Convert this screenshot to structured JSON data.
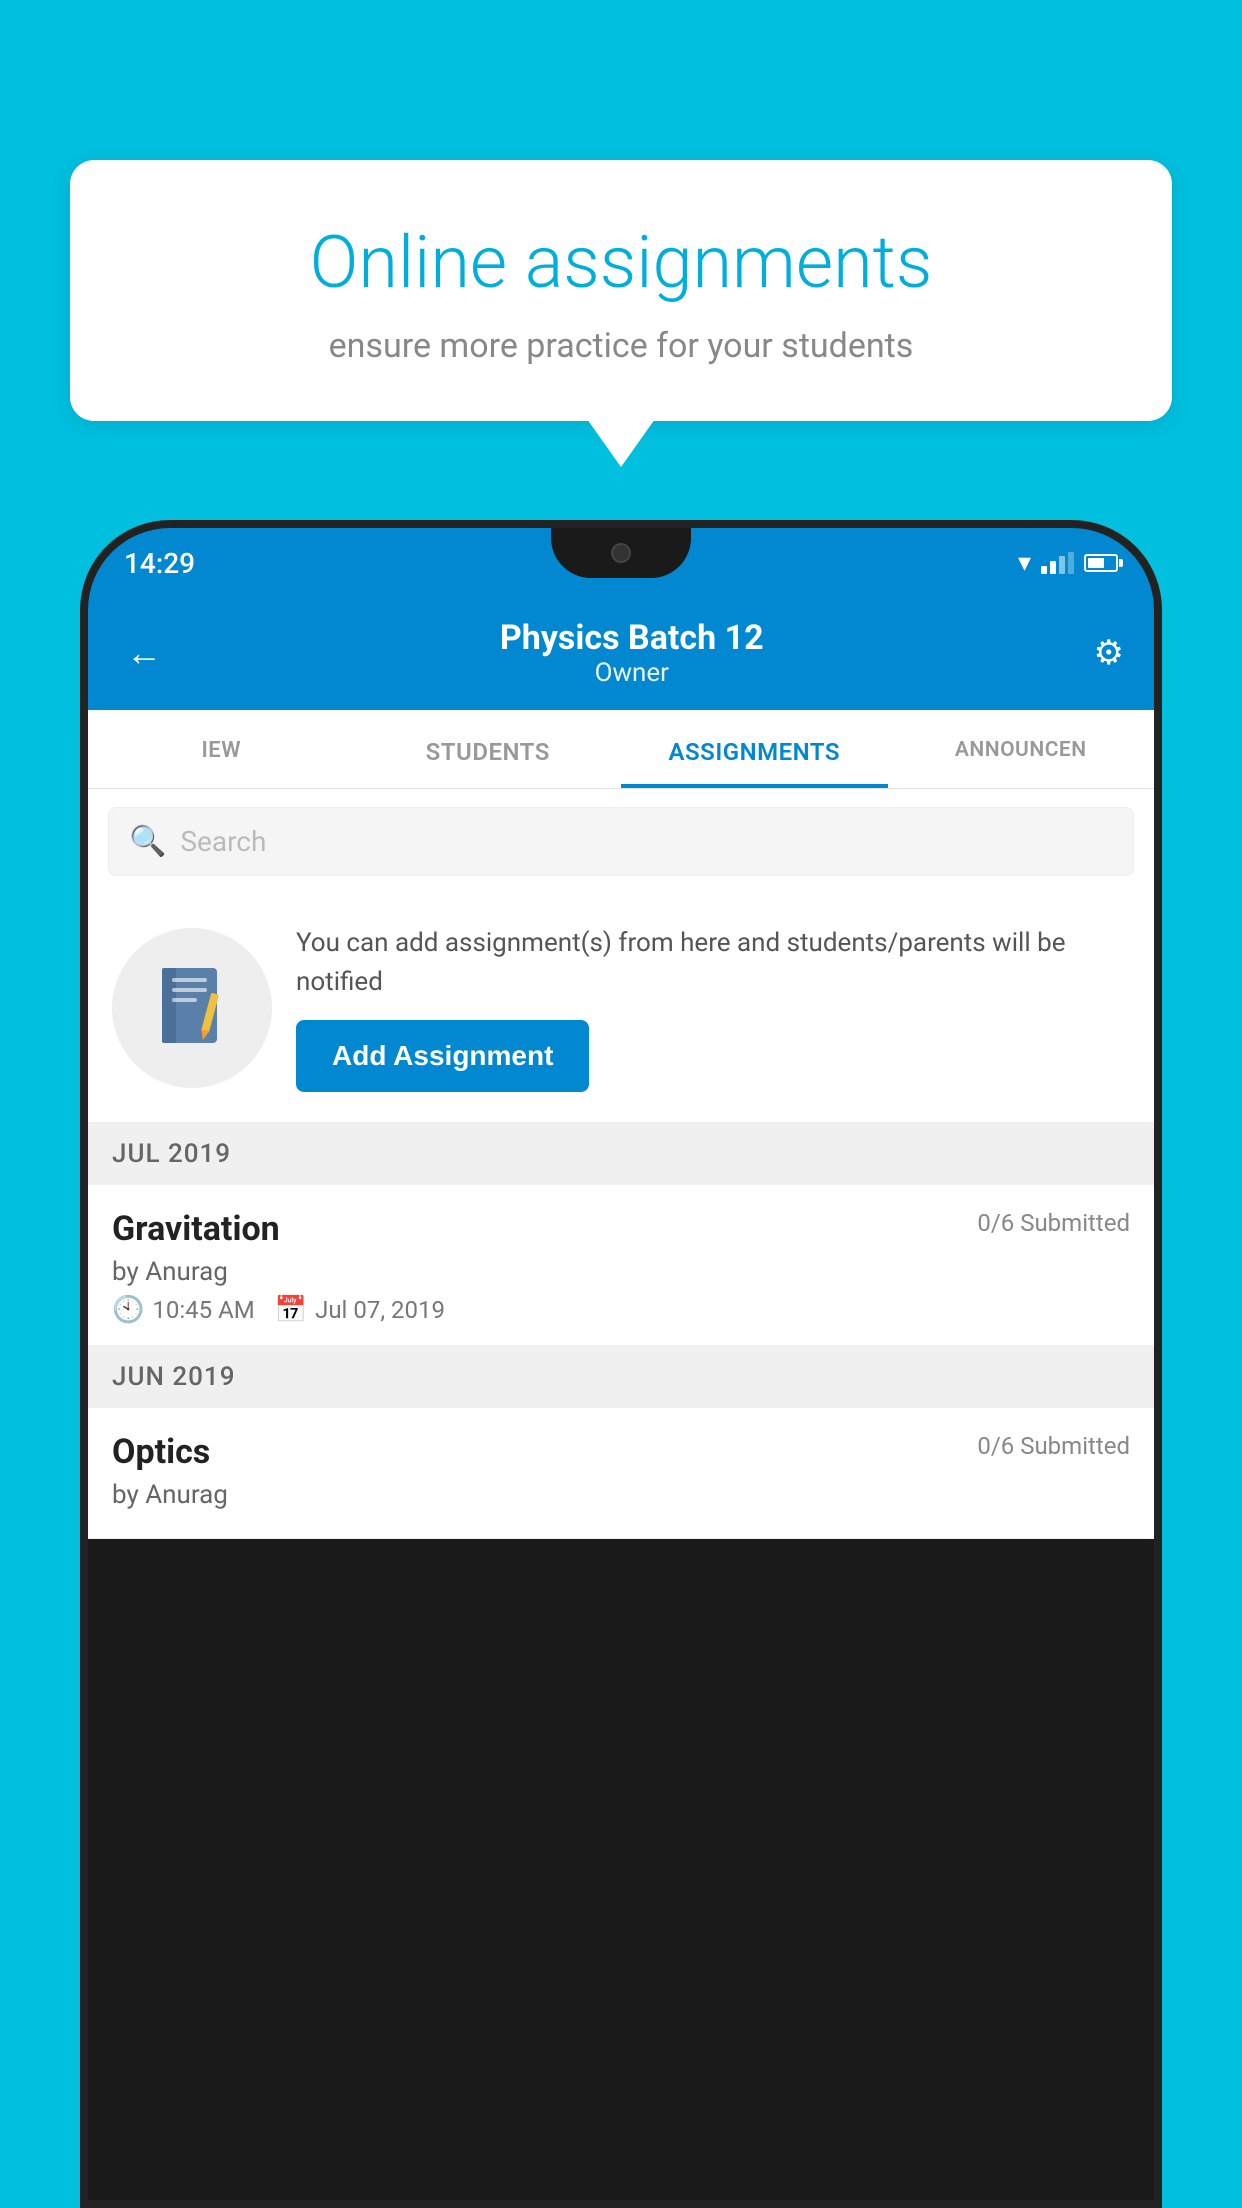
{
  "background": {
    "color": "#00BFDF"
  },
  "speech_bubble": {
    "title": "Online assignments",
    "subtitle": "ensure more practice for your students"
  },
  "status_bar": {
    "time": "14:29"
  },
  "app_header": {
    "title": "Physics Batch 12",
    "subtitle": "Owner",
    "back_label": "←",
    "settings_label": "⚙"
  },
  "tabs": [
    {
      "label": "IEW",
      "active": false
    },
    {
      "label": "STUDENTS",
      "active": false
    },
    {
      "label": "ASSIGNMENTS",
      "active": true
    },
    {
      "label": "ANNOUNCEN",
      "active": false
    }
  ],
  "search": {
    "placeholder": "Search"
  },
  "add_assignment": {
    "description": "You can add assignment(s) from here and students/parents will be notified",
    "button_label": "Add Assignment"
  },
  "sections": [
    {
      "month": "JUL 2019",
      "items": [
        {
          "name": "Gravitation",
          "submitted": "0/6 Submitted",
          "author": "by Anurag",
          "time": "10:45 AM",
          "date": "Jul 07, 2019"
        }
      ]
    },
    {
      "month": "JUN 2019",
      "items": [
        {
          "name": "Optics",
          "submitted": "0/6 Submitted",
          "author": "by Anurag",
          "time": "",
          "date": ""
        }
      ]
    }
  ]
}
